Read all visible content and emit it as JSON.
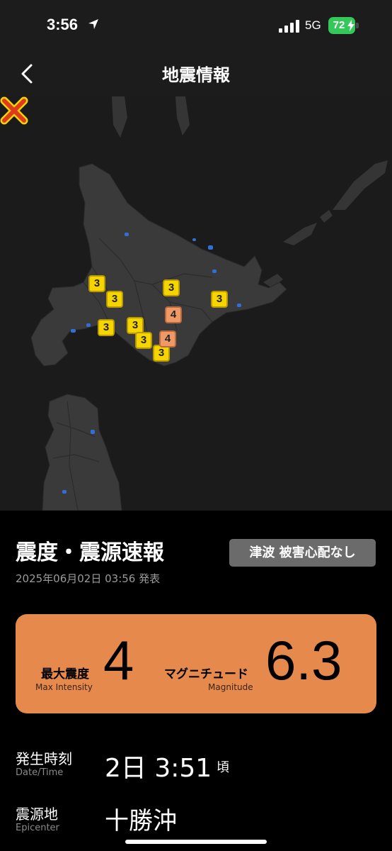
{
  "status_bar": {
    "time": "3:56",
    "network": "5G",
    "battery": "72",
    "icons": [
      "location-arrow-icon",
      "signal-bars-icon",
      "battery-charging-icon"
    ]
  },
  "nav": {
    "title": "地震情報",
    "back_icon": "chevron-left-icon"
  },
  "map": {
    "intensity_markers": [
      "3",
      "3",
      "3",
      "3",
      "3",
      "3",
      "3",
      "3",
      "3",
      "4",
      "4"
    ],
    "epicenter_icon": "x-mark-icon",
    "colors": {
      "land": "#3a3a3a",
      "sea": "#1b1b1b",
      "lakes": "#2f6fd6",
      "intensity_3": "#f5d400",
      "intensity_4": "#ef9a66",
      "epicenter": "#e03a1e"
    }
  },
  "report": {
    "title": "震度・震源速報",
    "tsunami": "津波 被害心配なし",
    "issued": "2025年06月02日 03:56 発表",
    "max_intensity_label": "最大震度",
    "max_intensity_label_en": "Max Intensity",
    "max_intensity": "4",
    "magnitude_label": "マグニチュード",
    "magnitude_label_en": "Magnitude",
    "magnitude": "6.3",
    "datetime_label": "発生時刻",
    "datetime_label_en": "Date/Time",
    "datetime": "2日 3:51",
    "datetime_suffix": "頃",
    "epicenter_label": "震源地",
    "epicenter_label_en": "Epicenter",
    "epicenter": "十勝沖",
    "card_color": "#e6894c"
  }
}
